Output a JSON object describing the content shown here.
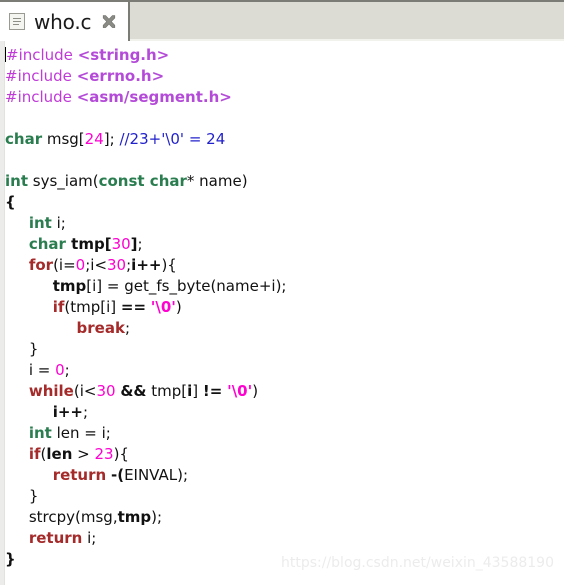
{
  "window": {
    "title": "who.c"
  },
  "tab_bar": {
    "tabs": [
      {
        "label": "who.c",
        "file_icon": "file-document-icon",
        "close_icon": "close-x-icon",
        "active": true
      }
    ]
  },
  "colors": {
    "tab_bar_background": "#dcdcd4",
    "tab_background": "#ffffff",
    "editor_background": "#ffffff",
    "gutter": "#ececeb",
    "preprocessor": "#c03ad8",
    "header_name": "#b44bd8",
    "keyword_type": "#2a7d4f",
    "keyword_control": "#a52a2a",
    "number": "#ff00d0",
    "string": "#ff00d0",
    "comment": "#2222cc",
    "identifier": "#111111",
    "watermark": "#ececec"
  },
  "editor": {
    "language": "C",
    "caret_line": 1,
    "lines": [
      {
        "n": 1,
        "tokens": [
          {
            "t": "caret",
            "v": ""
          },
          {
            "t": "pre",
            "v": "#include "
          },
          {
            "t": "header",
            "v": "<string.h>"
          }
        ]
      },
      {
        "n": 2,
        "tokens": [
          {
            "t": "pre",
            "v": "#include "
          },
          {
            "t": "header",
            "v": "<errno.h>"
          }
        ]
      },
      {
        "n": 3,
        "tokens": [
          {
            "t": "pre",
            "v": "#include "
          },
          {
            "t": "header",
            "v": "<asm/segment.h>"
          }
        ]
      },
      {
        "n": 4,
        "tokens": []
      },
      {
        "n": 5,
        "tokens": [
          {
            "t": "kw",
            "v": "char"
          },
          {
            "t": "plain",
            "v": " msg["
          },
          {
            "t": "num",
            "v": "24"
          },
          {
            "t": "plain",
            "v": "]; "
          },
          {
            "t": "cmt",
            "v": "//23+'\\0' = 24"
          }
        ]
      },
      {
        "n": 6,
        "tokens": []
      },
      {
        "n": 7,
        "tokens": [
          {
            "t": "kw",
            "v": "int"
          },
          {
            "t": "plain",
            "v": " sys_iam("
          },
          {
            "t": "kw",
            "v": "const char"
          },
          {
            "t": "plain",
            "v": "* name)"
          }
        ]
      },
      {
        "n": 8,
        "tokens": [
          {
            "t": "bold",
            "v": "{"
          }
        ]
      },
      {
        "n": 9,
        "tokens": [
          {
            "t": "plain",
            "v": "     "
          },
          {
            "t": "kw",
            "v": "int"
          },
          {
            "t": "plain",
            "v": " i;"
          }
        ]
      },
      {
        "n": 10,
        "tokens": [
          {
            "t": "plain",
            "v": "     "
          },
          {
            "t": "kw",
            "v": "char"
          },
          {
            "t": "bold",
            "v": " tmp["
          },
          {
            "t": "num",
            "v": "30"
          },
          {
            "t": "bold",
            "v": "]"
          },
          {
            "t": "plain",
            "v": ";"
          }
        ]
      },
      {
        "n": 11,
        "tokens": [
          {
            "t": "plain",
            "v": "     "
          },
          {
            "t": "ctl",
            "v": "for"
          },
          {
            "t": "plain",
            "v": "(i="
          },
          {
            "t": "num",
            "v": "0"
          },
          {
            "t": "plain",
            "v": ";i<"
          },
          {
            "t": "num",
            "v": "30"
          },
          {
            "t": "plain",
            "v": ";"
          },
          {
            "t": "bold",
            "v": "i++"
          },
          {
            "t": "plain",
            "v": "){"
          }
        ]
      },
      {
        "n": 12,
        "tokens": [
          {
            "t": "plain",
            "v": "          "
          },
          {
            "t": "bold",
            "v": "tmp"
          },
          {
            "t": "plain",
            "v": "[i] = get_fs_byte(name+i);"
          }
        ]
      },
      {
        "n": 13,
        "tokens": [
          {
            "t": "plain",
            "v": "          "
          },
          {
            "t": "ctl",
            "v": "if"
          },
          {
            "t": "plain",
            "v": "(tmp[i] "
          },
          {
            "t": "bold",
            "v": "=="
          },
          {
            "t": "plain",
            "v": " "
          },
          {
            "t": "str",
            "v": "'\\0'"
          },
          {
            "t": "plain",
            "v": ")"
          }
        ]
      },
      {
        "n": 14,
        "tokens": [
          {
            "t": "plain",
            "v": "               "
          },
          {
            "t": "ctl",
            "v": "break"
          },
          {
            "t": "plain",
            "v": ";"
          }
        ]
      },
      {
        "n": 15,
        "tokens": [
          {
            "t": "plain",
            "v": "     "
          },
          {
            "t": "plain",
            "v": "}"
          }
        ]
      },
      {
        "n": 16,
        "tokens": [
          {
            "t": "plain",
            "v": "     i = "
          },
          {
            "t": "num",
            "v": "0"
          },
          {
            "t": "plain",
            "v": ";"
          }
        ]
      },
      {
        "n": 17,
        "tokens": [
          {
            "t": "plain",
            "v": "     "
          },
          {
            "t": "ctl",
            "v": "while"
          },
          {
            "t": "plain",
            "v": "(i<"
          },
          {
            "t": "num",
            "v": "30"
          },
          {
            "t": "plain",
            "v": " "
          },
          {
            "t": "bold",
            "v": "&&"
          },
          {
            "t": "plain",
            "v": " tmp["
          },
          {
            "t": "bold",
            "v": "i"
          },
          {
            "t": "plain",
            "v": "] "
          },
          {
            "t": "bold",
            "v": "!="
          },
          {
            "t": "plain",
            "v": " "
          },
          {
            "t": "str",
            "v": "'\\0'"
          },
          {
            "t": "plain",
            "v": ")"
          }
        ]
      },
      {
        "n": 18,
        "tokens": [
          {
            "t": "plain",
            "v": "          "
          },
          {
            "t": "bold",
            "v": "i++"
          },
          {
            "t": "plain",
            "v": ";"
          }
        ]
      },
      {
        "n": 19,
        "tokens": [
          {
            "t": "plain",
            "v": "     "
          },
          {
            "t": "kw",
            "v": "int"
          },
          {
            "t": "plain",
            "v": " len = i;"
          }
        ]
      },
      {
        "n": 20,
        "tokens": [
          {
            "t": "plain",
            "v": "     "
          },
          {
            "t": "ctl",
            "v": "if"
          },
          {
            "t": "plain",
            "v": "("
          },
          {
            "t": "bold",
            "v": "len"
          },
          {
            "t": "plain",
            "v": " > "
          },
          {
            "t": "num",
            "v": "23"
          },
          {
            "t": "plain",
            "v": "){"
          }
        ]
      },
      {
        "n": 21,
        "tokens": [
          {
            "t": "plain",
            "v": "          "
          },
          {
            "t": "ctl",
            "v": "return"
          },
          {
            "t": "plain",
            "v": " "
          },
          {
            "t": "bold",
            "v": "-("
          },
          {
            "t": "plain",
            "v": "EINVAL);"
          }
        ]
      },
      {
        "n": 22,
        "tokens": [
          {
            "t": "plain",
            "v": "     }"
          }
        ]
      },
      {
        "n": 23,
        "tokens": [
          {
            "t": "plain",
            "v": "     strcpy(msg,"
          },
          {
            "t": "bold",
            "v": "tmp"
          },
          {
            "t": "plain",
            "v": ");"
          }
        ]
      },
      {
        "n": 24,
        "tokens": [
          {
            "t": "plain",
            "v": "     "
          },
          {
            "t": "ctl",
            "v": "return"
          },
          {
            "t": "plain",
            "v": " i;"
          }
        ]
      },
      {
        "n": 25,
        "tokens": [
          {
            "t": "bold",
            "v": "}"
          }
        ]
      }
    ]
  },
  "watermark": {
    "text": "https://blog.csdn.net/weixin_43588190"
  }
}
